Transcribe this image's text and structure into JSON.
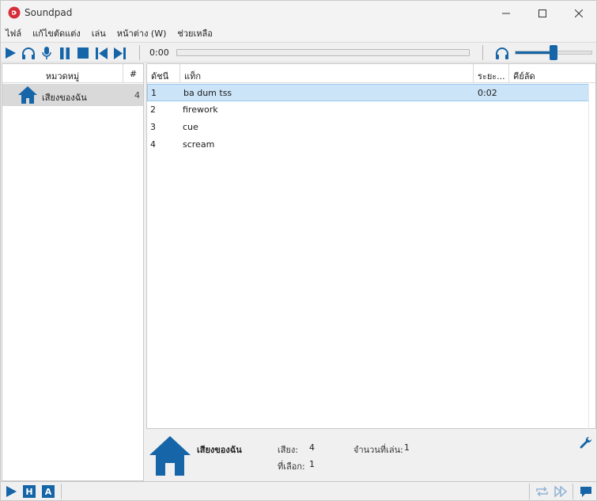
{
  "window": {
    "title": "Soundpad"
  },
  "menu": [
    "ไฟล์",
    "แก้ไขตัดแต่ง",
    "เล่น",
    "หน้าต่าง (W)",
    "ช่วยเหลือ"
  ],
  "toolbar": {
    "time": "0:00",
    "volume_level": 0.5
  },
  "categories": {
    "header_name": "หมวดหมู่",
    "header_count": "#",
    "items": [
      {
        "label": "เสียงของฉัน",
        "count": "4"
      }
    ]
  },
  "sound_list": {
    "columns": [
      "ดัชนี",
      "แท็ก",
      "ระยะ...",
      "คีย์ลัด"
    ],
    "rows": [
      {
        "index": "1",
        "tag": "ba dum tss",
        "duration": "0:02",
        "hotkey": "",
        "selected": true
      },
      {
        "index": "2",
        "tag": "firework",
        "duration": "",
        "hotkey": "",
        "selected": false
      },
      {
        "index": "3",
        "tag": "cue",
        "duration": "",
        "hotkey": "",
        "selected": false
      },
      {
        "index": "4",
        "tag": "scream",
        "duration": "",
        "hotkey": "",
        "selected": false
      }
    ]
  },
  "info": {
    "category": "เสียงของฉัน",
    "sounds_label": "เสียง:",
    "sounds_value": "4",
    "played_label": "จำนวนที่เล่น:",
    "played_value": "1",
    "selected_label": "ที่เลือก:",
    "selected_value": "1"
  },
  "colors": {
    "accent": "#1565a8",
    "selection": "#cce4f7",
    "app_icon": "#d62d3a"
  }
}
